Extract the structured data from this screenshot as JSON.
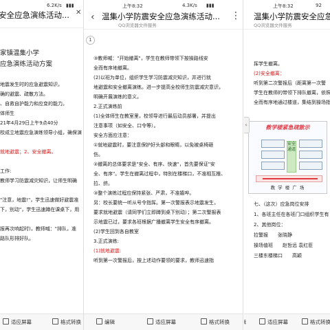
{
  "pane1": {
    "status_speed": "6.2K/s",
    "title": "安全应急演练活动...",
    "body_lines": [
      "家镇温集小学",
      "应急演练活动方案",
      "",
      "地震发生时的应急避震知识，",
      "确的避震、疏散方法。",
      "、自救自护能力和应变的能力。",
      "体师生",
      "21年4月29日上午9点40分",
      "校成立地震应急演练领导小组，确保演",
      "",
      "就地避震；2、安全撤离。",
      "",
      "工作:",
      "教师学习防震减灾知识，让师生明确",
      "",
      "\"注意，地震!\"，学生迅速做好避震准",
      "下，别动\"，学生迅速蹲在课桌下，用",
      "",
      "报再次响起时)，教师喊：\"排队，准",
      "路队形排好队。"
    ],
    "toolbar": [
      "适应屏幕",
      "格式转换"
    ]
  },
  "pane2": {
    "status_time": "上午8:32",
    "status_speed": "4.3K/s",
    "title": "温集小学防震安全应急演练活动...",
    "subtitle": "QQ浏览器文件服务",
    "page_number": "1",
    "body_lines": [
      "③教师喊：\"开始撤离\"，学生在教师带领下按操路线安",
      "全而有序地撤离。",
      "(2)以班为单位，组织学生学习防震减灾知识，并进行就",
      "地避震和安全撤离演练。进一步提高全校师生防震减灾意识，",
      "明确开展演练的意义。",
      "2.正式演练前",
      "(1)全体师生在教室里，校领导进行最后动员部署，并提出",
      "注意事项（如安全、口令等）。",
      "安全方面应注意：",
      "①就地避震时，要注意保护好头部和眼睛，以免被桌椅砸",
      "伤。",
      "②撤离的总体要求是\"安全、有序、快速\"，首先要保证\"安",
      "全、有序\"。学生在撤离过程中，特别在楼梯口，不准相互推、",
      "拉、挤。",
      "③整个演练过程应保持紧张、严肃，不准嬉哗。",
      "另：校长要统一听从号令指挥。第一次警报表示地震发生，",
      "要求就地避震（请同学们立即蹲到桌下别动）；第二次警报表",
      "示地震已过，要求各班根据广播撤离学生安全有序撤离。",
      "(2)学生回到各自教室",
      "3.正式演练:",
      "(1)就地避震:",
      "听到第一次警报后，按上述动作要领的要求，教师迅速指"
    ],
    "toolbar": [
      "编辑",
      "适应屏幕",
      "格式转换"
    ]
  },
  "pane3": {
    "status_time": "上午8:32",
    "status_speed": "92",
    "title": "温集小学防震安全应急演练活动...",
    "subtitle": "QQ浏览器文件服务",
    "body_top": [
      "挥学生撤离。",
      "(2)安全撤离：",
      "听到第二次警报后（距离第一次警",
      "学生在教师的带领下排队撤离，依照按",
      "全而有序地通过楼道，集结到操场指定位"
    ],
    "figure": {
      "title": "教学楼紧急疏散示",
      "center_label": "安全通道",
      "foot": "教 学 楼 广 场"
    },
    "body_bottom": [
      "七、（这次）应急岗位安排",
      "1、各班主任在各班门口组织学生有",
      "2、其他岗位：",
      "拉警报　　张晓静",
      "操场值班　　赵哲远 袁红臣",
      "三楼东楼梯口　　高颖"
    ],
    "toolbar": [
      "编辑",
      "适应屏幕",
      "格式转换"
    ]
  },
  "colors": {
    "accent_red": "#d11b1b",
    "figure_title": "#e0404c"
  }
}
